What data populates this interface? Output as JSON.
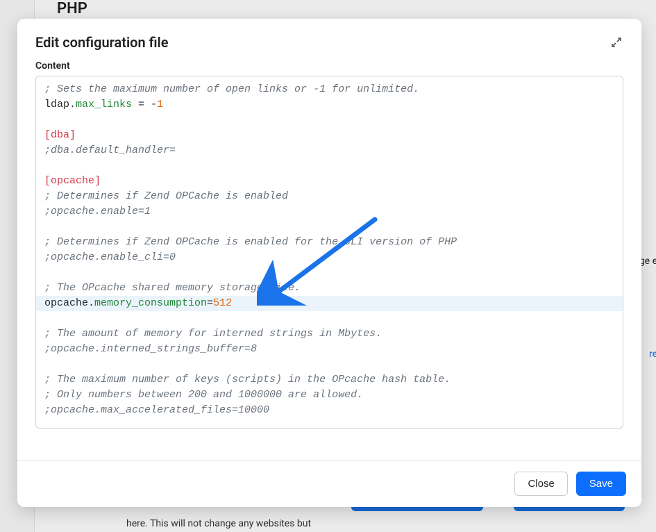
{
  "background": {
    "page_title": "PHP",
    "right_snippet_1": "ge e",
    "right_snippet_2": "re",
    "bottom_text": "here. This will not change any websites but"
  },
  "modal": {
    "title": "Edit configuration file",
    "content_label": "Content",
    "expand_icon": "expand-icon"
  },
  "editor": {
    "lines": [
      {
        "type": "comment",
        "text": "; Sets the maximum number of open links or -1 for unlimited."
      },
      {
        "type": "kv",
        "key": "ldap.",
        "prop": "max_links",
        "eq": " = ",
        "value": "-1",
        "value_num_part": "1",
        "value_prefix": "-"
      },
      {
        "type": "blank"
      },
      {
        "type": "section",
        "text": "[dba]"
      },
      {
        "type": "comment",
        "text": ";dba.default_handler="
      },
      {
        "type": "blank"
      },
      {
        "type": "section",
        "text": "[opcache]"
      },
      {
        "type": "comment",
        "text": "; Determines if Zend OPCache is enabled"
      },
      {
        "type": "comment",
        "text": ";opcache.enable=1"
      },
      {
        "type": "blank"
      },
      {
        "type": "comment",
        "text": "; Determines if Zend OPCache is enabled for the CLI version of PHP"
      },
      {
        "type": "comment",
        "text": ";opcache.enable_cli=0"
      },
      {
        "type": "blank"
      },
      {
        "type": "comment",
        "text": "; The OPcache shared memory storage size."
      },
      {
        "type": "kv_hl",
        "key": "opcache.",
        "prop": "memory_consumption",
        "eq": "=",
        "value": "512"
      },
      {
        "type": "blank"
      },
      {
        "type": "comment",
        "text": "; The amount of memory for interned strings in Mbytes."
      },
      {
        "type": "comment",
        "text": ";opcache.interned_strings_buffer=8"
      },
      {
        "type": "blank"
      },
      {
        "type": "comment",
        "text": "; The maximum number of keys (scripts) in the OPcache hash table."
      },
      {
        "type": "comment",
        "text": "; Only numbers between 200 and 1000000 are allowed."
      },
      {
        "type": "comment",
        "text": ";opcache.max_accelerated_files=10000"
      }
    ]
  },
  "annotation": {
    "arrow_color": "#1a73e8"
  },
  "footer": {
    "close_label": "Close",
    "save_label": "Save"
  }
}
